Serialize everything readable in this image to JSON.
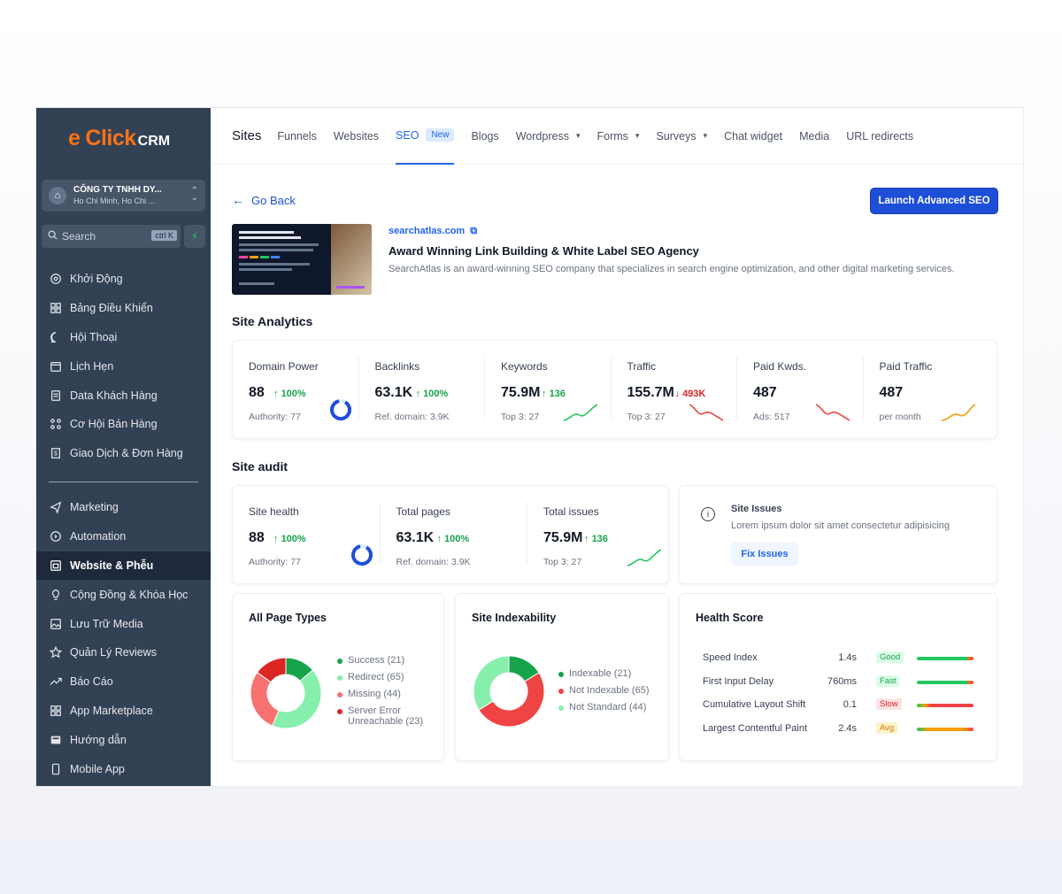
{
  "brand": {
    "logo_e": "e",
    "logo_click": "Click",
    "logo_crm": "CRM",
    "accent": "#f97316"
  },
  "company": {
    "name": "CÔNG TY TNHH DY...",
    "address": "Ho Chi Minh, Ho Chi ..."
  },
  "search": {
    "label": "Search",
    "shortcut": "ctrl K"
  },
  "sidebar": {
    "items_top": [
      {
        "label": "Khởi Động",
        "icon": "rocket-icon"
      },
      {
        "label": "Bảng Điều Khiển",
        "icon": "dashboard-icon"
      },
      {
        "label": "Hội Thoại",
        "icon": "chat-icon"
      },
      {
        "label": "Lịch Hẹn",
        "icon": "calendar-icon"
      },
      {
        "label": "Data Khách Hàng",
        "icon": "contacts-icon"
      },
      {
        "label": "Cơ Hội Bán Hàng",
        "icon": "pipeline-icon"
      },
      {
        "label": "Giao Dịch & Đơn Hàng",
        "icon": "receipt-icon"
      }
    ],
    "items_bottom": [
      {
        "label": "Marketing",
        "icon": "send-icon"
      },
      {
        "label": "Automation",
        "icon": "automation-icon"
      },
      {
        "label": "Website & Phễu",
        "icon": "website-icon",
        "active": true
      },
      {
        "label": "Cộng Đồng & Khóa Học",
        "icon": "community-icon"
      },
      {
        "label": "Lưu Trữ Media",
        "icon": "media-icon"
      },
      {
        "label": "Quản Lý Reviews",
        "icon": "star-icon"
      },
      {
        "label": "Báo Cáo",
        "icon": "trend-icon"
      },
      {
        "label": "App Marketplace",
        "icon": "apps-icon"
      },
      {
        "label": "Hướng dẫn",
        "icon": "guide-icon"
      },
      {
        "label": "Mobile App",
        "icon": "mobile-icon"
      }
    ]
  },
  "topnav": {
    "title": "Sites",
    "tabs": [
      {
        "label": "Funnels"
      },
      {
        "label": "Websites"
      },
      {
        "label": "SEO",
        "active": true,
        "badge": "New"
      },
      {
        "label": "Blogs"
      },
      {
        "label": "Wordpress",
        "dropdown": true
      },
      {
        "label": "Forms",
        "dropdown": true
      },
      {
        "label": "Surveys",
        "dropdown": true
      },
      {
        "label": "Chat widget"
      },
      {
        "label": "Media"
      },
      {
        "label": "URL redirects"
      }
    ]
  },
  "header": {
    "back_label": "Go Back",
    "launch_label": "Launch Advanced SEO"
  },
  "site": {
    "domain": "searchatlas.com",
    "title": "Award Winning Link Building & White Label SEO Agency",
    "description": "SearchAtlas is an award-winning SEO company that specializes in search engine optimization, and other digital marketing services."
  },
  "analytics": {
    "title": "Site Analytics",
    "metrics": [
      {
        "label": "Domain Power",
        "value": "88",
        "change": "100%",
        "dir": "up",
        "sub": "Authority: 77",
        "viz": "ring"
      },
      {
        "label": "Backlinks",
        "value": "63.1K",
        "change": "100%",
        "dir": "up",
        "sub": "Ref. domain: 3.9K",
        "viz": "none"
      },
      {
        "label": "Keywords",
        "value": "75.9M",
        "change": "136",
        "dir": "up",
        "sub": "Top 3: 27",
        "viz": "spark-up"
      },
      {
        "label": "Traffic",
        "value": "155.7M",
        "change": "493K",
        "dir": "down",
        "sub": "Top 3: 27",
        "viz": "spark-down"
      },
      {
        "label": "Paid Kwds.",
        "value": "487",
        "change": "",
        "dir": "",
        "sub": "Ads: 517",
        "viz": "spark-down"
      },
      {
        "label": "Paid Traffic",
        "value": "487",
        "change": "",
        "dir": "",
        "sub": "per month",
        "viz": "spark-orange"
      }
    ]
  },
  "audit": {
    "title": "Site audit",
    "metrics": [
      {
        "label": "Site health",
        "value": "88",
        "change": "100%",
        "sub": "Authority: 77",
        "viz": "ring"
      },
      {
        "label": "Total pages",
        "value": "63.1K",
        "change": "100%",
        "sub": "Ref. domain: 3.9K",
        "viz": "none"
      },
      {
        "label": "Total issues",
        "value": "75.9M",
        "change": "136",
        "sub": "Top 3: 27",
        "viz": "spark-up"
      }
    ],
    "issues": {
      "title": "Site Issues",
      "text": "Lorem ipsum dolor sit amet consectetur adipisicing",
      "button": "Fix Issues"
    }
  },
  "page_types": {
    "title": "All Page Types",
    "legend": [
      {
        "label": "Success (21)",
        "color": "#16a34a",
        "value": 21
      },
      {
        "label": "Redirect (65)",
        "color": "#86efac",
        "value": 65
      },
      {
        "label": "Missing (44)",
        "color": "#f87171",
        "value": 44
      },
      {
        "label": "Server Error",
        "label2": "Unreachable (23)",
        "color": "#dc2626",
        "value": 23
      }
    ]
  },
  "indexability": {
    "title": "Site Indexability",
    "legend": [
      {
        "label": "Indexable (21)",
        "color": "#16a34a",
        "value": 21
      },
      {
        "label": "Not Indexable (65)",
        "color": "#ef4444",
        "value": 65
      },
      {
        "label": "Not Standard (44)",
        "color": "#86efac",
        "value": 44
      }
    ]
  },
  "health": {
    "title": "Health Score",
    "rows": [
      {
        "name": "Speed Index",
        "value": "1.4s",
        "status": "Good",
        "status_color": "#16a34a",
        "status_bg": "#dcfce7",
        "bar": "green"
      },
      {
        "name": "First Input Delay",
        "value": "760ms",
        "status": "Fast",
        "status_color": "#16a34a",
        "status_bg": "#dcfce7",
        "bar": "green"
      },
      {
        "name": "Cumulative Layout Shift",
        "value": "0.1",
        "status": "Slow",
        "status_color": "#dc2626",
        "status_bg": "#fee2e2",
        "bar": "red"
      },
      {
        "name": "Largest Contentful Paint",
        "value": "2.4s",
        "status": "Avg",
        "status_color": "#d97706",
        "status_bg": "#fef3c7",
        "bar": "orange"
      }
    ]
  }
}
